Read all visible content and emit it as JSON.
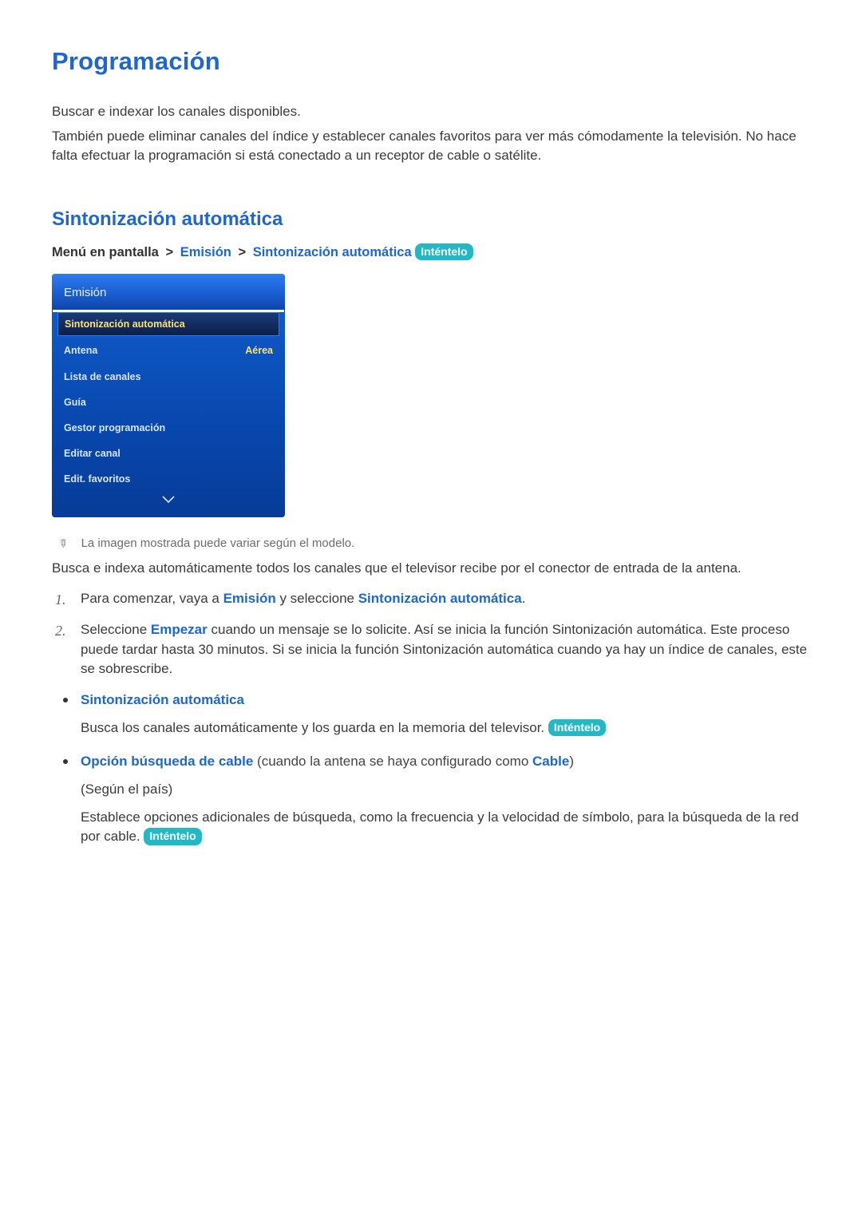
{
  "title": "Programación",
  "intro1": "Buscar e indexar los canales disponibles.",
  "intro2": "También puede eliminar canales del índice y establecer canales favoritos para ver más cómodamente la televisión. No hace falta efectuar la programación si está conectado a un receptor de cable o satélite.",
  "h2": "Sintonización automática",
  "crumb": {
    "prefix": "Menú en pantalla",
    "sep": ">",
    "a": "Emisión",
    "b": "Sintonización automática",
    "try": "Inténtelo"
  },
  "tv": {
    "header": "Emisión",
    "items": [
      {
        "label": "Sintonización automática",
        "value": "",
        "selected": true
      },
      {
        "label": "Antena",
        "value": "Aérea",
        "selected": false
      },
      {
        "label": "Lista de canales",
        "value": "",
        "selected": false
      },
      {
        "label": "Guía",
        "value": "",
        "selected": false
      },
      {
        "label": "Gestor programación",
        "value": "",
        "selected": false
      },
      {
        "label": "Editar canal",
        "value": "",
        "selected": false
      },
      {
        "label": "Edit. favoritos",
        "value": "",
        "selected": false
      }
    ]
  },
  "note": "La imagen mostrada puede variar según el modelo.",
  "autoDesc": "Busca e indexa automáticamente todos los canales que el televisor recibe por el conector de entrada de la antena.",
  "step1": {
    "pre": "Para comenzar, vaya a ",
    "k1": "Emisión",
    "mid": " y seleccione ",
    "k2": "Sintonización automática",
    "suf": "."
  },
  "step2": {
    "pre": "Seleccione ",
    "k": "Empezar",
    "suf": " cuando un mensaje se lo solicite. Así se inicia la función Sintonización automática. Este proceso puede tardar hasta 30 minutos. Si se inicia la función Sintonización automática cuando ya hay un índice de canales, este se sobrescribe."
  },
  "bul1": {
    "head": "Sintonización automática",
    "body": "Busca los canales automáticamente y los guarda en la memoria del televisor. ",
    "try": "Inténtelo"
  },
  "bul2": {
    "head": "Opción búsqueda de cable",
    "paren_pre": " (cuando la antena se haya configurado como ",
    "paren_k": "Cable",
    "paren_suf": ")",
    "note": "(Según el país)",
    "body": "Establece opciones adicionales de búsqueda, como la frecuencia y la velocidad de símbolo, para la búsqueda de la red por cable. ",
    "try": "Inténtelo"
  }
}
